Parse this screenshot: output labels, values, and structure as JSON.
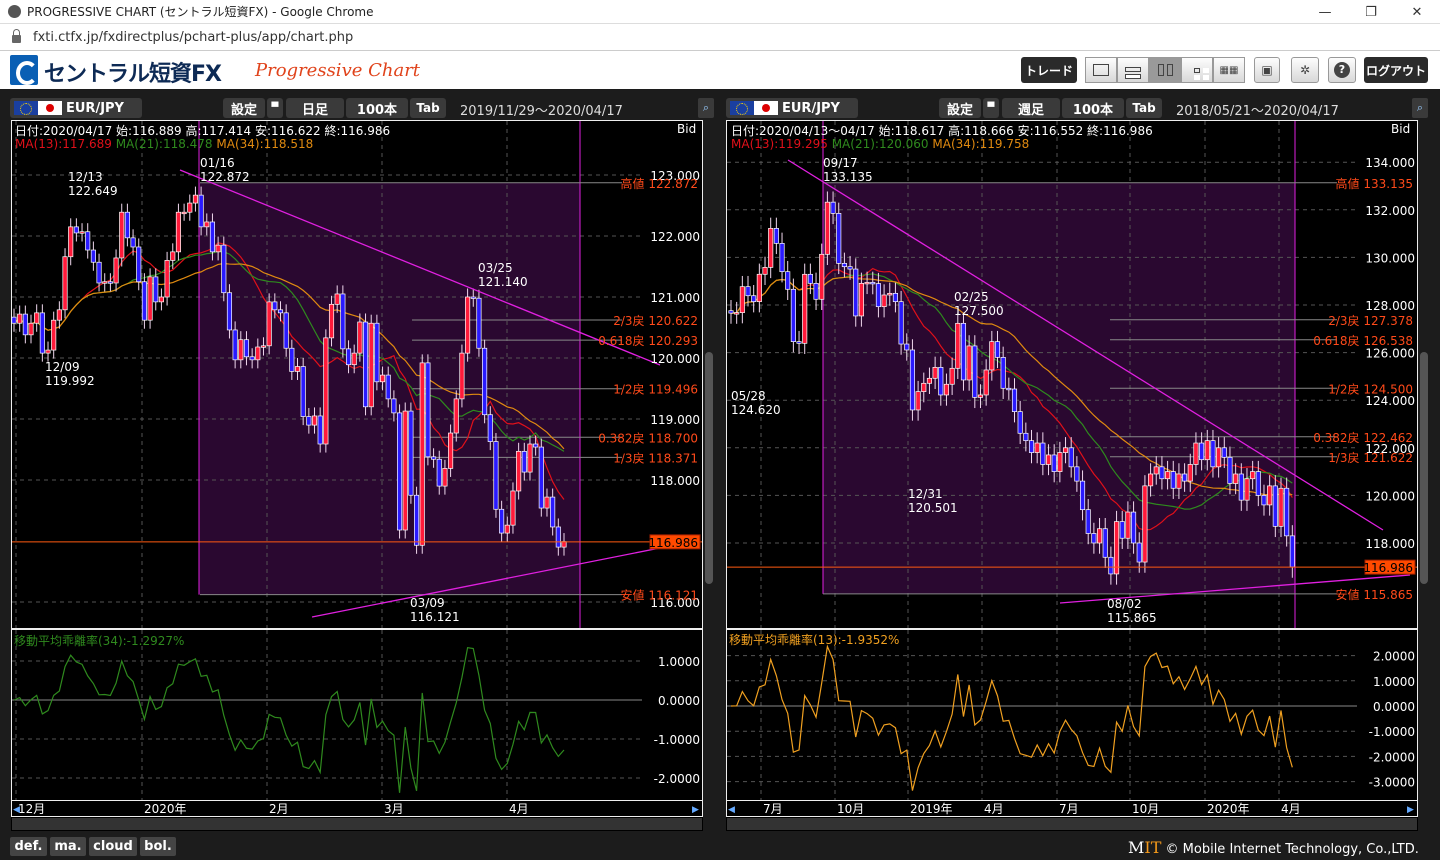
{
  "browser": {
    "title": "PROGRESSIVE CHART (セントラル短資FX) - Google Chrome",
    "url": "fxti.ctfx.jp/fxdirectplus/pchart-plus/app/chart.php",
    "controls": [
      "—",
      "❐",
      "✕"
    ]
  },
  "app": {
    "logo": "セントラル短資FX",
    "product": "Progressive Chart",
    "trade": "トレード",
    "logout": "ログアウト",
    "layouts": [
      "1",
      "2-horizontal",
      "2-vertical",
      "4",
      "16"
    ],
    "active_layout": "2-vertical",
    "save_icon": "floppy-icon",
    "settings_icon": "gear-icon",
    "help_icon": "help-icon"
  },
  "colors": {
    "up": "#ff1a3a",
    "down": "#2a1aff",
    "ma13": "#e0101a",
    "ma21": "#2f8a1e",
    "ma34": "#e08a10",
    "fib": "#ff4a1a",
    "trend": "#e020e0",
    "shade": "#2a0830"
  },
  "charts": [
    {
      "pair": "EUR/JPY",
      "settings": "設定",
      "period": "日足",
      "bars": "100本",
      "tab": "Tab",
      "range": "2019/11/29〜2020/04/17",
      "info": "日付:2020/04/17 始:116.889 高:117.414 安:116.622 終:116.986",
      "side": "Bid",
      "ma": [
        {
          "label": "MA(13):117.689",
          "n": 13
        },
        {
          "label": "MA(21):118.478",
          "n": 21
        },
        {
          "label": "MA(34):118.518",
          "n": 34
        }
      ],
      "yticks": [
        "123.000",
        "122.000",
        "121.000",
        "120.000",
        "119.000",
        "118.000",
        "116.000"
      ],
      "fib": [
        {
          "label": "高値 122.872",
          "price": 122.872
        },
        {
          "label": "2/3戻 120.622",
          "price": 120.622
        },
        {
          "label": "0.618戻 120.293",
          "price": 120.293
        },
        {
          "label": "1/2戻 119.496",
          "price": 119.496
        },
        {
          "label": "0.382戻 118.700",
          "price": 118.7
        },
        {
          "label": "1/3戻 118.371",
          "price": 118.371
        },
        {
          "label": "安値 116.121",
          "price": 116.121
        }
      ],
      "last": "116.986",
      "last_price": 116.986,
      "annotations": [
        {
          "date": "12/13",
          "value": "122.649"
        },
        {
          "date": "01/16",
          "value": "122.872"
        },
        {
          "date": "12/09",
          "value": "119.992"
        },
        {
          "date": "03/25",
          "value": "121.140"
        },
        {
          "date": "03/09",
          "value": "116.121"
        }
      ],
      "indicator": {
        "label": "移動平均乖離率(34):-1.2927%",
        "n": 34,
        "yticks": [
          "1.0000",
          "0.0000",
          "-1.0000",
          "-2.0000"
        ]
      },
      "xlabels": [
        "12月",
        "2020年",
        "2月",
        "3月",
        "4月"
      ],
      "closes": [
        120.57,
        120.72,
        120.38,
        120.57,
        120.74,
        120.08,
        120.13,
        120.62,
        120.79,
        121.66,
        122.15,
        122.05,
        122.07,
        121.77,
        121.57,
        121.23,
        121.25,
        121.23,
        121.64,
        122.39,
        121.97,
        121.82,
        121.25,
        120.62,
        121.33,
        120.92,
        121.0,
        121.6,
        121.74,
        122.39,
        122.39,
        122.54,
        122.67,
        122.15,
        122.23,
        121.74,
        121.85,
        121.07,
        120.46,
        119.97,
        120.3,
        120.02,
        119.97,
        120.18,
        120.2,
        120.92,
        120.79,
        120.74,
        120.16,
        119.78,
        119.86,
        119.04,
        118.9,
        119.05,
        118.59,
        120.33,
        120.88,
        121.05,
        120.15,
        119.89,
        120.08,
        120.59,
        119.2,
        120.57,
        119.61,
        119.72,
        119.33,
        119.1,
        117.18,
        119.13,
        117.75,
        116.93,
        119.92,
        118.38,
        118.34,
        117.9,
        118.19,
        118.77,
        119.33,
        120.08,
        121.0,
        120.98,
        120.16,
        119.07,
        118.63,
        117.52,
        117.13,
        117.26,
        117.82,
        118.47,
        118.13,
        118.59,
        118.54,
        117.54,
        117.72,
        117.23,
        116.9,
        116.99
      ]
    },
    {
      "pair": "EUR/JPY",
      "settings": "設定",
      "period": "週足",
      "bars": "100本",
      "tab": "Tab",
      "range": "2018/05/21〜2020/04/17",
      "info": "日付:2020/04/13〜04/17 始:118.617 高:118.666 安:116.552 終:116.986",
      "side": "Bid",
      "ma": [
        {
          "label": "MA(13):119.295",
          "n": 13
        },
        {
          "label": "MA(21):120.060",
          "n": 21
        },
        {
          "label": "MA(34):119.758",
          "n": 34
        }
      ],
      "yticks": [
        "134.000",
        "132.000",
        "130.000",
        "128.000",
        "126.000",
        "124.000",
        "122.000",
        "120.000",
        "118.000"
      ],
      "fib": [
        {
          "label": "高値 133.135",
          "price": 133.135
        },
        {
          "label": "2/3戻 127.378",
          "price": 127.378
        },
        {
          "label": "0.618戻 126.538",
          "price": 126.538
        },
        {
          "label": "1/2戻 124.500",
          "price": 124.5
        },
        {
          "label": "0.382戻 122.462",
          "price": 122.462
        },
        {
          "label": "1/3戻 121.622",
          "price": 121.622
        },
        {
          "label": "安値 115.865",
          "price": 115.865
        }
      ],
      "last": "116.986",
      "last_price": 116.986,
      "annotations": [
        {
          "date": "09/17",
          "value": "133.135"
        },
        {
          "date": "05/28",
          "value": "124.620"
        },
        {
          "date": "02/25",
          "value": "127.500"
        },
        {
          "date": "12/31",
          "value": "120.501"
        },
        {
          "date": "08/02",
          "value": "115.865"
        }
      ],
      "indicator": {
        "label": "移動平均乖離率(13):-1.9352%",
        "n": 13,
        "yticks": [
          "2.0000",
          "1.0000",
          "0.0000",
          "-1.0000",
          "-2.0000",
          "-3.0000"
        ]
      },
      "xlabels": [
        "7月",
        "10月",
        "2019年",
        "4月",
        "7月",
        "10月",
        "2020年",
        "4月"
      ],
      "closes": [
        127.66,
        127.68,
        128.77,
        128.39,
        128.14,
        129.29,
        129.58,
        131.22,
        130.59,
        129.4,
        128.66,
        126.46,
        126.39,
        129.29,
        128.91,
        128.24,
        130.13,
        132.32,
        131.85,
        129.75,
        129.61,
        129.51,
        127.54,
        128.91,
        128.95,
        128.9,
        127.93,
        128.42,
        128.49,
        128.14,
        126.36,
        126.11,
        123.59,
        124.36,
        124.71,
        124.92,
        125.38,
        124.22,
        124.67,
        125.34,
        127.23,
        124.85,
        126.28,
        124.12,
        124.22,
        125.27,
        126.46,
        125.8,
        124.5,
        124.47,
        123.52,
        122.61,
        122.3,
        121.8,
        122.2,
        121.3,
        121.7,
        121.0,
        121.8,
        122.0,
        121.2,
        120.6,
        119.4,
        118.4,
        118.0,
        118.6,
        117.4,
        116.7,
        118.9,
        118.2,
        119.3,
        118.0,
        117.2,
        120.4,
        120.9,
        121.2,
        120.7,
        121.0,
        120.3,
        120.9,
        120.6,
        121.3,
        122.2,
        121.5,
        122.3,
        121.2,
        122.0,
        121.6,
        120.5,
        120.9,
        119.8,
        120.7,
        121.0,
        120.0,
        119.6,
        120.4,
        118.7,
        120.3,
        118.3,
        116.99
      ]
    }
  ],
  "footer": {
    "buttons": [
      "def.",
      "ma.",
      "cloud",
      "bol."
    ],
    "copyright": "© Mobile Internet Technology, Co.,LTD.",
    "brand": "MIT"
  }
}
